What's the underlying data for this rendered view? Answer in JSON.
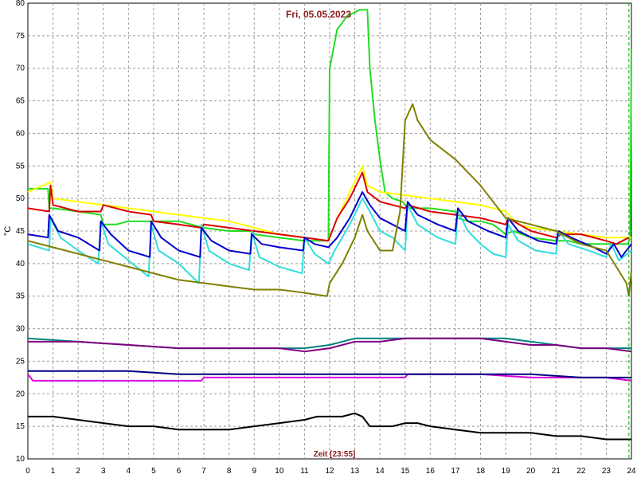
{
  "chart_data": {
    "type": "line",
    "title": "Fri, 05.05.2023",
    "xlabel": "Zeit [23:55]",
    "ylabel": "°C",
    "xlim": [
      0,
      24
    ],
    "ylim": [
      10,
      80
    ],
    "xticks": [
      0,
      1,
      2,
      3,
      4,
      5,
      6,
      7,
      8,
      9,
      10,
      11,
      12,
      13,
      14,
      15,
      16,
      17,
      18,
      19,
      20,
      21,
      22,
      23,
      24
    ],
    "yticks": [
      10,
      15,
      20,
      25,
      30,
      35,
      40,
      45,
      50,
      55,
      60,
      65,
      70,
      75,
      80
    ],
    "grid": true,
    "marker_x": 23.9,
    "series": [
      {
        "color": "#22dd22",
        "x": [
          0,
          0.8,
          0.85,
          1,
          2,
          2.9,
          3,
          3.5,
          4,
          5,
          6,
          7,
          8,
          8.9,
          9,
          10,
          11,
          11.95,
          12,
          12.3,
          12.7,
          13.2,
          13.5,
          13.6,
          13.8,
          14,
          14.2,
          14.5,
          14.9,
          15,
          15.2,
          16,
          17,
          17.1,
          17.5,
          18,
          18.5,
          19,
          19.3,
          20,
          21,
          21.5,
          22,
          23,
          23.7,
          23.85,
          23.95,
          24
        ],
        "y": [
          51.5,
          51.5,
          48.5,
          48.5,
          48,
          47.5,
          46,
          46,
          46.5,
          46.5,
          46.5,
          45.5,
          45,
          45,
          44.5,
          44,
          43.5,
          43.5,
          70,
          76,
          78,
          79,
          79,
          70,
          62,
          56,
          51,
          50,
          49.5,
          49,
          48.5,
          48.5,
          48,
          47,
          46.5,
          46.5,
          46,
          44.5,
          45,
          44,
          43.5,
          43.5,
          43,
          43,
          43,
          43,
          44,
          73
        ]
      },
      {
        "color": "#ffff00",
        "x": [
          0,
          0.9,
          1,
          2,
          3,
          4,
          5,
          6,
          7,
          8,
          9,
          10,
          11,
          11.95,
          12.2,
          12.8,
          13.3,
          13.5,
          14,
          15,
          16,
          17,
          18,
          19,
          19.5,
          20,
          21,
          22,
          23,
          24
        ],
        "y": [
          51,
          52.5,
          50,
          49.5,
          49,
          48.5,
          48,
          47.5,
          47,
          46.5,
          45.5,
          44.5,
          44,
          43.5,
          46,
          51,
          55,
          52,
          51,
          50.5,
          50,
          49.5,
          49,
          48,
          46,
          45.5,
          45,
          44.5,
          44,
          44
        ]
      },
      {
        "color": "#dd0000",
        "x": [
          0,
          0.85,
          0.9,
          1,
          2,
          2.9,
          3,
          4,
          4.9,
          5,
          6,
          6.9,
          7,
          8,
          9,
          10,
          11,
          11.95,
          12.3,
          12.8,
          13.3,
          13.5,
          14,
          15,
          15.1,
          16,
          17,
          18,
          19,
          19.1,
          20,
          21,
          21.2,
          22,
          23,
          23.4,
          23.9
        ],
        "y": [
          48.5,
          48,
          52,
          49,
          48,
          48,
          49,
          48,
          47.5,
          46.5,
          46,
          45.5,
          46,
          45.5,
          45,
          44.5,
          44,
          43.5,
          47,
          50,
          54,
          51,
          49.5,
          48.5,
          49,
          48,
          47.5,
          47,
          46,
          47,
          45,
          44,
          44.5,
          44.5,
          43.5,
          43,
          44
        ]
      },
      {
        "color": "#33dddd",
        "x": [
          0,
          0.85,
          0.9,
          1.3,
          2,
          2.8,
          2.9,
          3.2,
          4,
          4.8,
          4.9,
          5.2,
          6,
          6.8,
          6.9,
          7.2,
          8,
          8.8,
          8.9,
          9.2,
          10,
          10.9,
          11,
          11.4,
          11.95,
          12.2,
          12.8,
          13.3,
          13.6,
          14,
          14.5,
          15,
          15.1,
          15.5,
          16.3,
          17,
          17.1,
          17.5,
          18,
          18.5,
          19,
          19.1,
          19.5,
          20.2,
          21,
          21.1,
          21.5,
          22.3,
          23,
          23.2,
          23.5,
          24
        ],
        "y": [
          43,
          42,
          47,
          44,
          42,
          40,
          46.5,
          43,
          40.5,
          38,
          46,
          42,
          40,
          37,
          46,
          42,
          40,
          39,
          45,
          41,
          39.5,
          38.5,
          44,
          41.5,
          40,
          42,
          46,
          50,
          48,
          45,
          44,
          42,
          49,
          46,
          44,
          43,
          48,
          45,
          43,
          41.5,
          41,
          46,
          43.5,
          42,
          41.5,
          45,
          43,
          42,
          41,
          43,
          40.5,
          42
        ]
      },
      {
        "color": "#0000cc",
        "x": [
          0,
          0.8,
          0.85,
          1.2,
          2,
          2.85,
          2.9,
          3.3,
          4,
          4.85,
          4.9,
          5.3,
          6,
          6.85,
          6.9,
          7.3,
          8,
          8.85,
          8.9,
          9.3,
          10,
          10.95,
          11,
          11.4,
          11.95,
          12.3,
          12.8,
          13.3,
          13.6,
          14,
          14.5,
          15,
          15.1,
          15.5,
          16.3,
          17,
          17.1,
          17.5,
          18.3,
          19,
          19.1,
          19.5,
          20.3,
          21,
          21.1,
          21.6,
          22.5,
          23,
          23.3,
          23.6,
          24
        ],
        "y": [
          44.5,
          44,
          47.5,
          45,
          44,
          42,
          46.5,
          44.5,
          42,
          41,
          46.5,
          44,
          42,
          41,
          45.5,
          43.5,
          42,
          41.5,
          44.5,
          43,
          42.5,
          42,
          44,
          43,
          42.5,
          44,
          47,
          51,
          49,
          47,
          46,
          45,
          49.5,
          47.5,
          46,
          45,
          48.5,
          46.5,
          45,
          44,
          47,
          45,
          43.5,
          43,
          45,
          44,
          42.5,
          41.5,
          43,
          41,
          43
        ]
      },
      {
        "color": "#808000",
        "x": [
          0,
          1,
          2,
          3,
          4,
          5,
          6,
          7,
          8,
          9,
          10,
          11,
          11.9,
          12,
          12.5,
          13,
          13.3,
          13.5,
          14,
          14.5,
          14.8,
          15,
          15.3,
          15.5,
          16,
          17,
          18,
          19,
          20,
          21,
          22,
          23,
          23.8,
          23.9,
          24
        ],
        "y": [
          43.5,
          42.5,
          41.5,
          40.5,
          39.5,
          38.5,
          37.5,
          37,
          36.5,
          36,
          36,
          35.5,
          35,
          37,
          40,
          44,
          47.5,
          45,
          42,
          42,
          48,
          62,
          64.5,
          62,
          59,
          56,
          52,
          47,
          46,
          45,
          43,
          42,
          37,
          35,
          39
        ]
      },
      {
        "color": "#008080",
        "x": [
          0,
          2,
          4,
          6,
          8,
          10,
          11,
          12,
          13,
          14,
          15,
          16,
          17,
          18,
          19,
          20,
          21,
          22,
          23,
          24
        ],
        "y": [
          28.5,
          28,
          27.5,
          27,
          27,
          27,
          27,
          27.5,
          28.5,
          28.5,
          28.5,
          28.5,
          28.5,
          28.5,
          28.5,
          28,
          27.5,
          27,
          27,
          27
        ]
      },
      {
        "color": "#800080",
        "x": [
          0,
          2,
          4,
          6,
          8,
          10,
          11,
          12,
          13,
          14,
          15,
          16,
          17,
          18,
          19,
          20,
          21,
          22,
          23,
          24
        ],
        "y": [
          28,
          28,
          27.5,
          27,
          27,
          27,
          26.5,
          27,
          28,
          28,
          28.5,
          28.5,
          28.5,
          28.5,
          28,
          27.5,
          27.5,
          27,
          27,
          26.5
        ]
      },
      {
        "color": "#dd00dd",
        "x": [
          0,
          0.1,
          0.2,
          6.9,
          7,
          15,
          15.1,
          18,
          20,
          21,
          22,
          23,
          24
        ],
        "y": [
          23,
          22.5,
          22,
          22,
          22.5,
          22.5,
          23,
          23,
          22.5,
          22.5,
          22.5,
          22.5,
          22
        ]
      },
      {
        "color": "#000080",
        "x": [
          0,
          2,
          4,
          6,
          8,
          10,
          12,
          14,
          16,
          18,
          20,
          22,
          24
        ],
        "y": [
          23.5,
          23.5,
          23.5,
          23,
          23,
          23,
          23,
          23,
          23,
          23,
          23,
          22.5,
          22.5
        ]
      },
      {
        "color": "#000000",
        "x": [
          0,
          1,
          2,
          3,
          4,
          5,
          6,
          7,
          8,
          9,
          10,
          11,
          11.5,
          12,
          12.5,
          13,
          13.3,
          13.6,
          14,
          14.5,
          15,
          15.5,
          16,
          17,
          18,
          19,
          20,
          21,
          22,
          23,
          23.5,
          24
        ],
        "y": [
          16.5,
          16.5,
          16,
          15.5,
          15,
          15,
          14.5,
          14.5,
          14.5,
          15,
          15.5,
          16,
          16.5,
          16.5,
          16.5,
          17,
          16.5,
          15,
          15,
          15,
          15.5,
          15.5,
          15,
          14.5,
          14,
          14,
          14,
          13.5,
          13.5,
          13,
          13,
          13
        ]
      }
    ]
  }
}
